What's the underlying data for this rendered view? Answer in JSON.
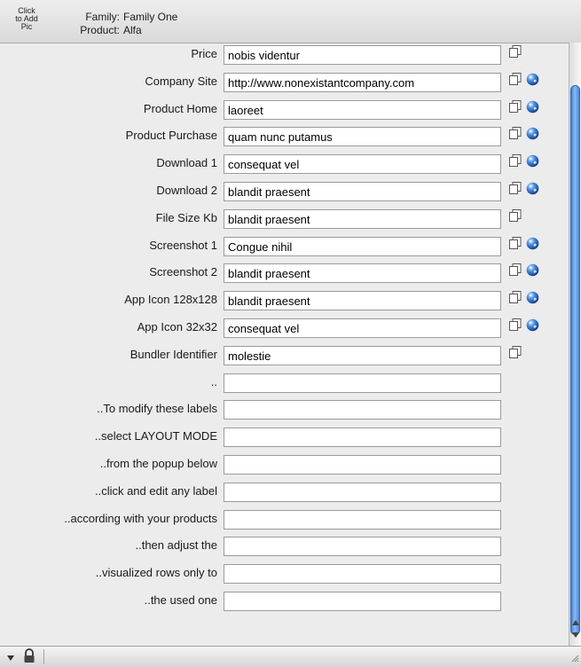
{
  "header": {
    "pic_button": [
      "Click",
      "to Add",
      "Pic"
    ],
    "family_label": "Family:",
    "family_value": "Family One",
    "product_label": "Product:",
    "product_value": "Alfa"
  },
  "rows": [
    {
      "label": "Price",
      "value": "nobis videntur",
      "copy": true,
      "globe": false
    },
    {
      "label": "Company Site",
      "value": "http://www.nonexistantcompany.com",
      "copy": true,
      "globe": true
    },
    {
      "label": "Product Home",
      "value": "laoreet",
      "copy": true,
      "globe": true
    },
    {
      "label": "Product Purchase",
      "value": "quam nunc putamus",
      "copy": true,
      "globe": true
    },
    {
      "label": "Download 1",
      "value": "consequat vel",
      "copy": true,
      "globe": true
    },
    {
      "label": "Download 2",
      "value": "blandit praesent",
      "copy": true,
      "globe": true
    },
    {
      "label": "File Size Kb",
      "value": "blandit praesent",
      "copy": true,
      "globe": false
    },
    {
      "label": "Screenshot 1",
      "value": "Congue nihil",
      "copy": true,
      "globe": true
    },
    {
      "label": "Screenshot 2",
      "value": "blandit praesent",
      "copy": true,
      "globe": true
    },
    {
      "label": "App Icon 128x128",
      "value": "blandit praesent",
      "copy": true,
      "globe": true
    },
    {
      "label": "App Icon 32x32",
      "value": "consequat vel",
      "copy": true,
      "globe": true
    },
    {
      "label": "Bundler Identifier",
      "value": "molestie",
      "copy": true,
      "globe": false
    },
    {
      "label": "..",
      "value": "",
      "copy": false,
      "globe": false
    },
    {
      "label": "..To modify these labels",
      "value": "",
      "copy": false,
      "globe": false
    },
    {
      "label": "..select LAYOUT MODE",
      "value": "",
      "copy": false,
      "globe": false
    },
    {
      "label": "..from the popup below",
      "value": "",
      "copy": false,
      "globe": false
    },
    {
      "label": "..click and edit any label",
      "value": "",
      "copy": false,
      "globe": false
    },
    {
      "label": "..according with your products",
      "value": "",
      "copy": false,
      "globe": false
    },
    {
      "label": "..then adjust the",
      "value": "",
      "copy": false,
      "globe": false
    },
    {
      "label": "..visualized rows only to",
      "value": "",
      "copy": false,
      "globe": false
    },
    {
      "label": "..the used one",
      "value": "",
      "copy": false,
      "globe": false
    }
  ],
  "icons": {
    "copy": "copy-icon",
    "globe": "globe-icon",
    "lock": "lock-icon",
    "menu": "popup-menu-icon"
  },
  "colors": {
    "accent": "#3f7fd6",
    "field_border": "#9b9b9b",
    "background": "#ececec"
  }
}
